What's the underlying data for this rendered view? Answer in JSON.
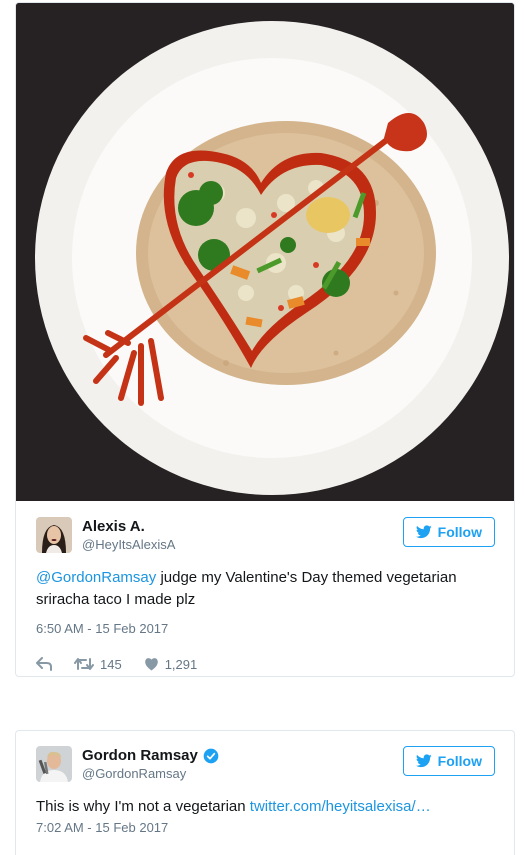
{
  "tweet1": {
    "author_name": "Alexis A.",
    "author_handle": "@HeyItsAlexisA",
    "follow_label": "Follow",
    "mention": "@GordonRamsay",
    "text": " judge my Valentine's Day themed vegetarian sriracha taco I made plz",
    "timestamp": "6:50 AM - 15 Feb 2017",
    "retweets": "145",
    "likes": "1,291",
    "photo_icon": "photo-taco-heart"
  },
  "tweet2": {
    "author_name": "Gordon Ramsay",
    "author_handle": "@GordonRamsay",
    "follow_label": "Follow",
    "text": "This is why I'm not a vegetarian ",
    "link": "twitter.com/heyitsalexisa/…",
    "timestamp": "7:02 AM - 15 Feb 2017"
  },
  "colors": {
    "twitter_blue": "#1da1f2",
    "link_blue": "#1b95e0",
    "muted": "#657786",
    "border": "#e1e8ed"
  }
}
